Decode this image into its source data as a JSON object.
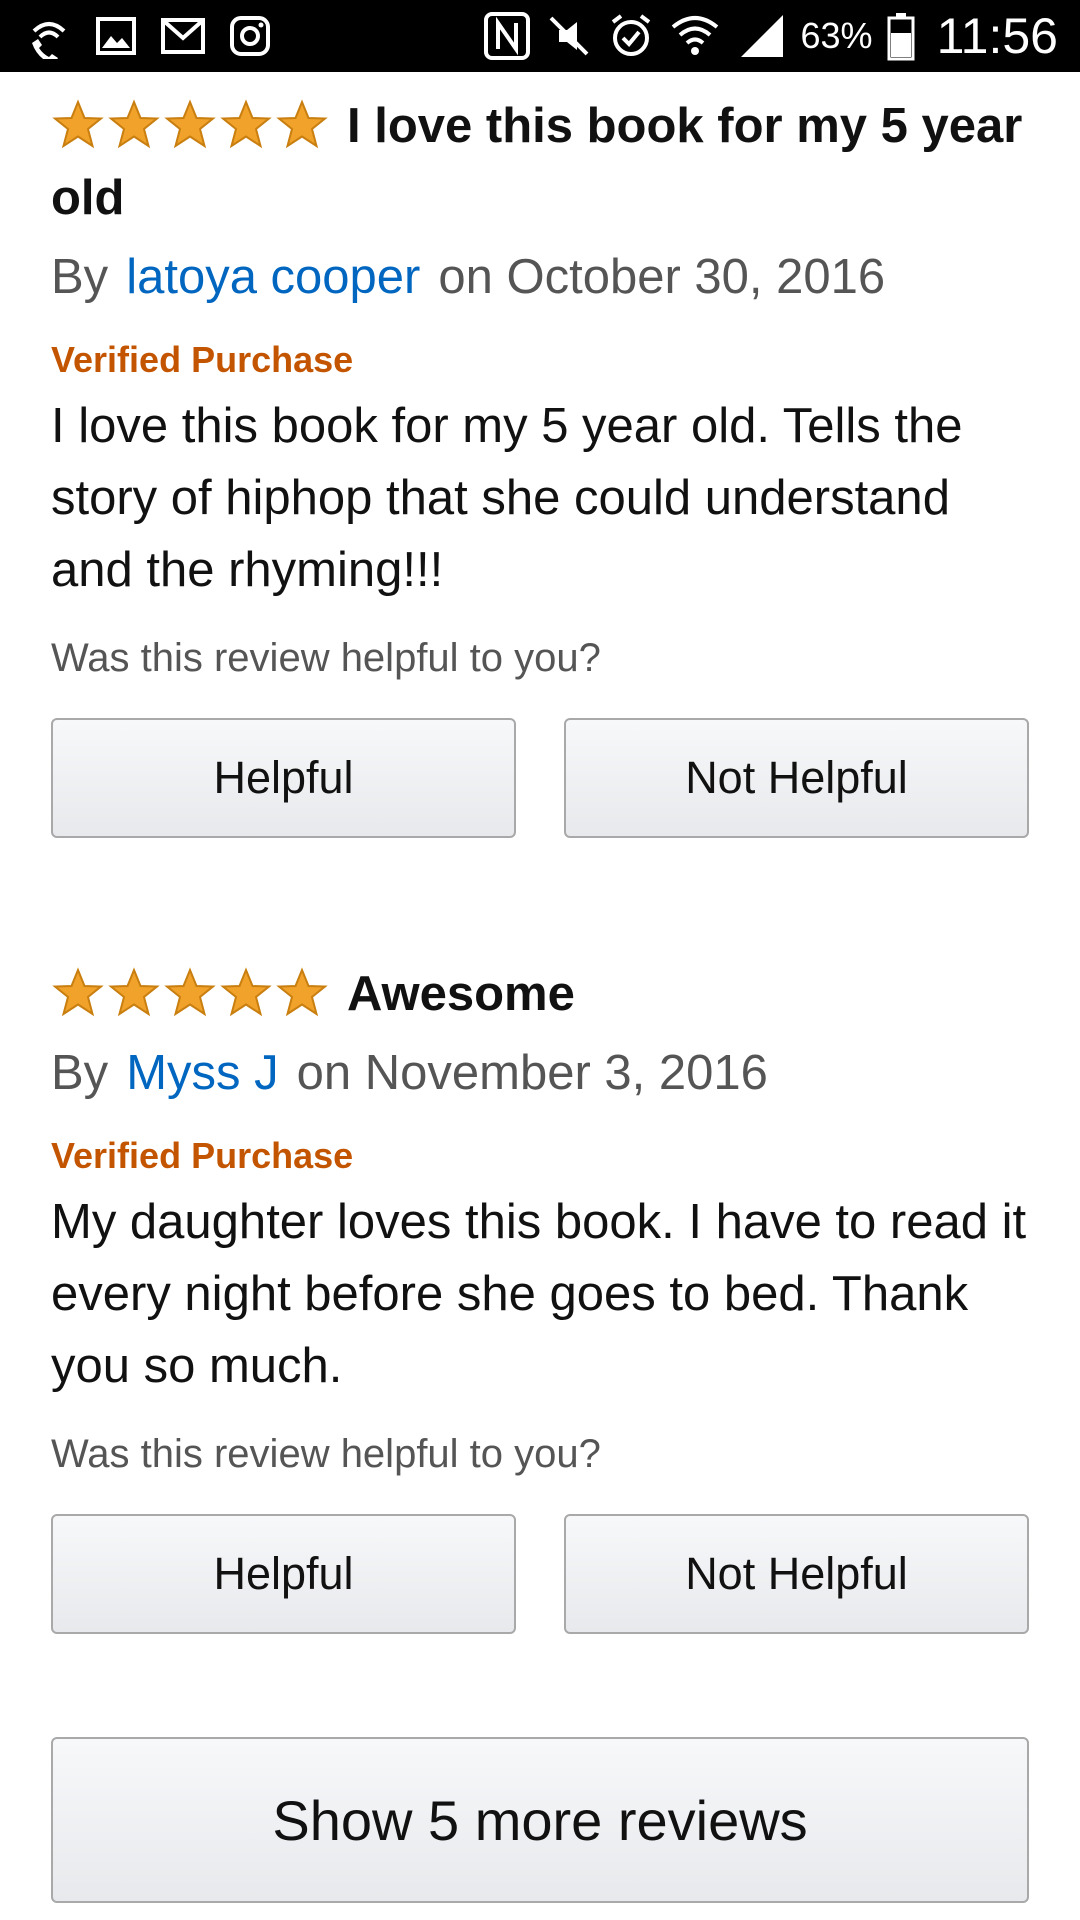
{
  "status_bar": {
    "left_icons": [
      "wifi-calling-icon",
      "image-icon",
      "gmail-icon",
      "instagram-icon"
    ],
    "right_icons": [
      "nfc-icon",
      "vibrate-off-icon",
      "alarm-icon",
      "wifi-icon",
      "signal-icon",
      "battery-icon"
    ],
    "battery_percent": "63%",
    "time": "11:56"
  },
  "rating_color": "#f0a22b",
  "reviews": [
    {
      "stars": 5,
      "title": "I love this book for my 5 year old",
      "by_label": "By",
      "author": "latoya cooper",
      "date": "on October 30, 2016",
      "verified": "Verified Purchase",
      "body": "I love this book for my 5 year old. Tells the story of hiphop that she could understand and the rhyming!!!",
      "helpful_question": "Was this review helpful to you?",
      "helpful_label": "Helpful",
      "not_helpful_label": "Not Helpful"
    },
    {
      "stars": 5,
      "title": "Awesome",
      "by_label": "By",
      "author": "Myss J",
      "date": "on November 3, 2016",
      "verified": "Verified Purchase",
      "body": "My daughter loves this book. I have to read it every night before she goes to bed. Thank you so much.",
      "helpful_question": "Was this review helpful to you?",
      "helpful_label": "Helpful",
      "not_helpful_label": "Not Helpful"
    }
  ],
  "show_more_label": "Show 5 more reviews"
}
